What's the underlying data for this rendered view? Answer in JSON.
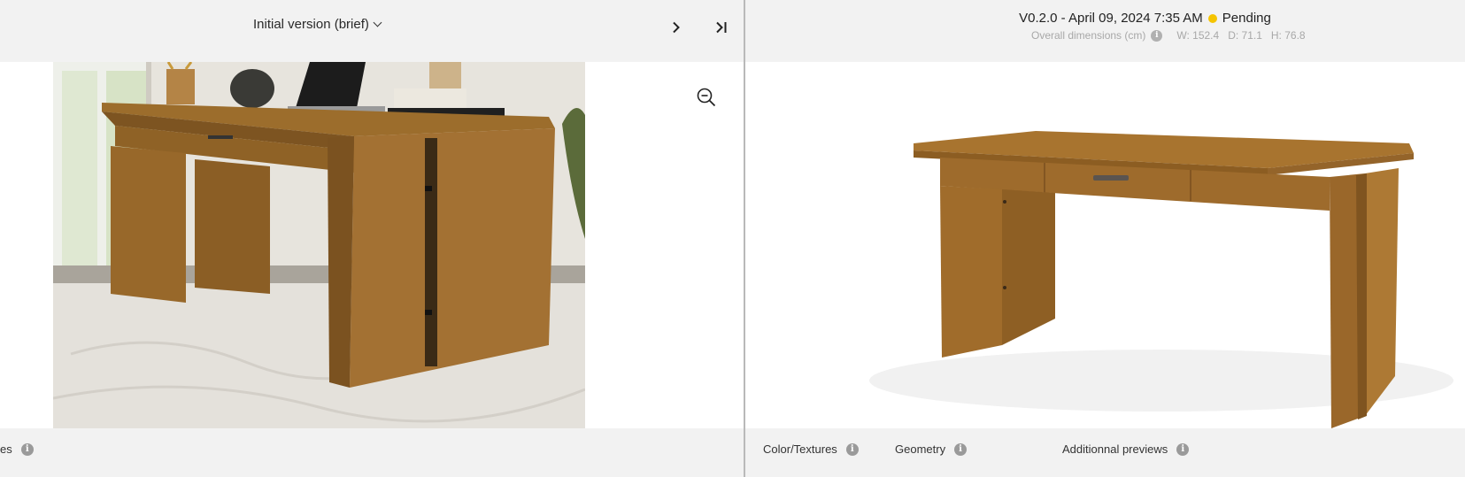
{
  "left_panel": {
    "version_selector": {
      "label": "Initial version (brief)"
    },
    "next_icon": "chevron-right-icon",
    "last_icon": "skip-to-end-icon",
    "zoom_icon": "zoom-out-icon",
    "bottom_tab_label": "es"
  },
  "right_panel": {
    "version": {
      "text": "V0.2.0 - April 09, 2024 7:35 AM",
      "status": "Pending",
      "status_color": "#f5c400"
    },
    "dimensions": {
      "label": "Overall dimensions (cm)",
      "width": "W: 152.4",
      "depth": "D: 71.1",
      "height": "H: 76.8"
    },
    "tabs": [
      {
        "label": "Color/Textures"
      },
      {
        "label": "Geometry"
      },
      {
        "label": "Additionnal previews"
      }
    ]
  },
  "colors": {
    "bar_background": "#f2f2f2",
    "divider": "#b9b9b9",
    "wood": "#a8742f"
  }
}
